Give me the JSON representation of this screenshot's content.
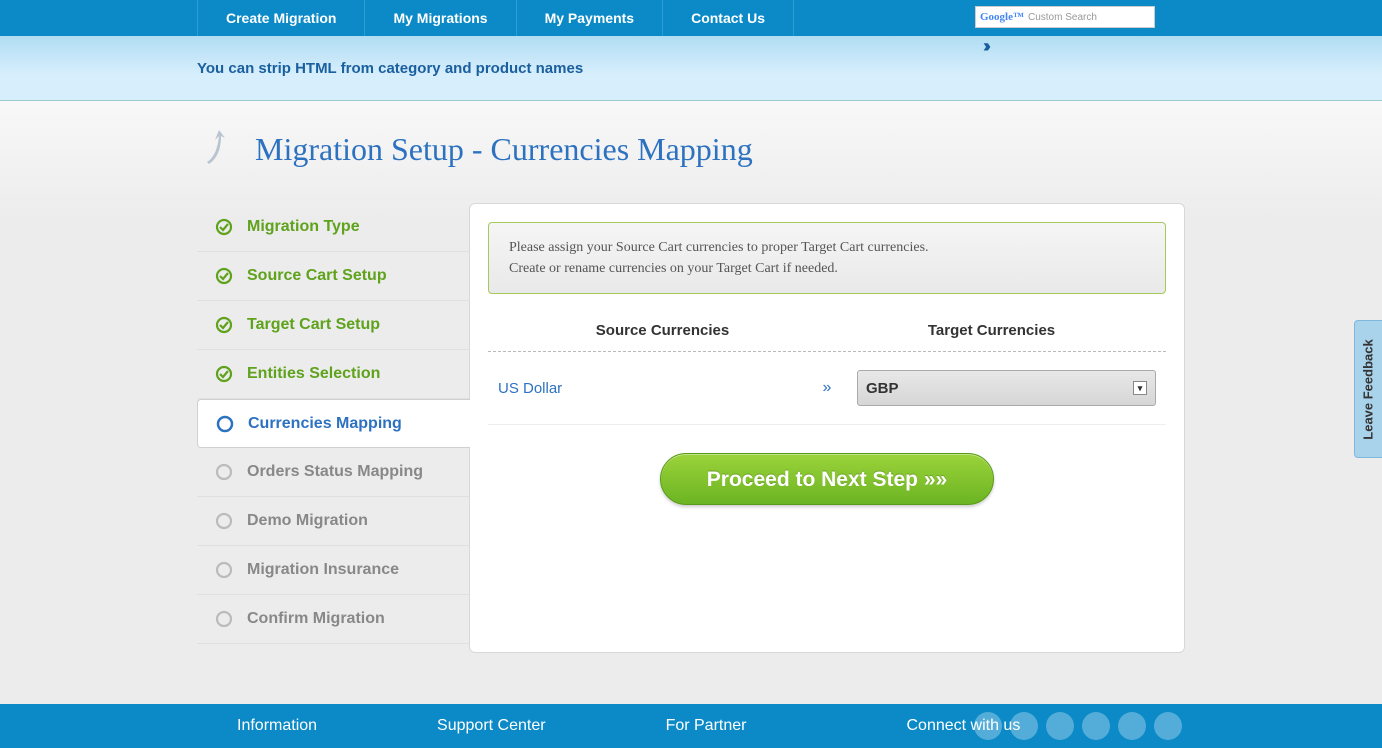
{
  "nav": {
    "items": [
      "Create Migration",
      "My Migrations",
      "My Payments",
      "Contact Us"
    ],
    "search_brand": "Google™",
    "search_placeholder": "Custom Search"
  },
  "banner": {
    "text": "You can strip HTML from category and product names",
    "chevrons": "››"
  },
  "page": {
    "title": "Migration Setup - Currencies Mapping"
  },
  "sidebar": {
    "steps": [
      {
        "label": "Migration Type",
        "state": "done"
      },
      {
        "label": "Source Cart Setup",
        "state": "done"
      },
      {
        "label": "Target Cart Setup",
        "state": "done"
      },
      {
        "label": "Entities Selection",
        "state": "done"
      },
      {
        "label": "Currencies Mapping",
        "state": "current"
      },
      {
        "label": "Orders Status Mapping",
        "state": "pending"
      },
      {
        "label": "Demo Migration",
        "state": "pending"
      },
      {
        "label": "Migration Insurance",
        "state": "pending"
      },
      {
        "label": "Confirm Migration",
        "state": "pending"
      }
    ]
  },
  "panel": {
    "info_line1": "Please assign your Source Cart currencies to proper Target Cart currencies.",
    "info_line2": "Create or rename currencies on your Target Cart if needed.",
    "header_source": "Source Currencies",
    "header_target": "Target Currencies",
    "mappings": [
      {
        "source": "US Dollar",
        "arrow": "»",
        "target": "GBP"
      }
    ],
    "proceed_label": "Proceed to Next Step »»"
  },
  "footer": {
    "cols": [
      "Information",
      "Support Center",
      "For Partner",
      "Connect with us"
    ]
  },
  "feedback": {
    "label": "Leave Feedback"
  }
}
